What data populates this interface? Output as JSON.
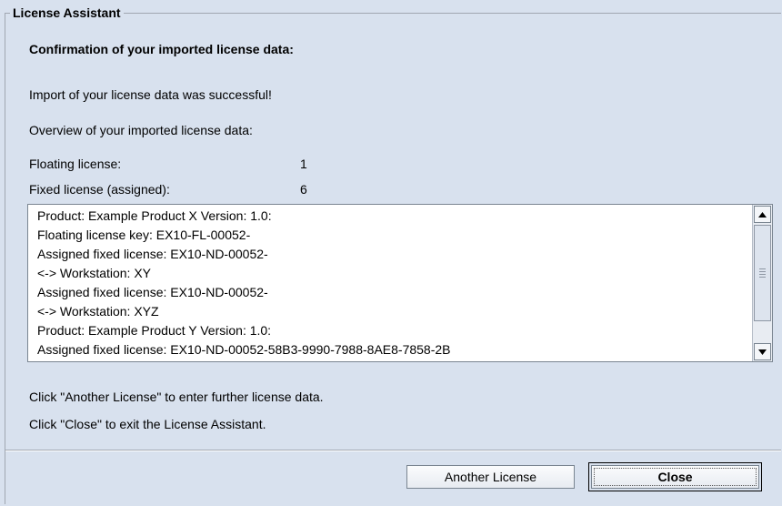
{
  "dialog": {
    "group_title": "License Assistant",
    "heading": "Confirmation of your imported license data:",
    "success_message": "Import of your license data was successful!",
    "overview_label": "Overview of your imported license data:",
    "floating_label": "Floating license:",
    "floating_value": "1",
    "fixed_label": "Fixed license (assigned):",
    "fixed_value": "6",
    "license_lines": [
      "Product: Example Product X  Version: 1.0:",
      "Floating license key: EX10-FL-00052-",
      "Assigned fixed license: EX10-ND-00052-",
      " <-> Workstation: XY",
      "Assigned fixed license: EX10-ND-00052-",
      " <-> Workstation: XYZ",
      "Product: Example Product Y  Version: 1.0:",
      "Assigned fixed license: EX10-ND-00052-58B3-9990-7988-8AE8-7858-2B"
    ],
    "hint_another": "Click \"Another License\" to enter further license data.",
    "hint_close": "Click \"Close\" to exit the License Assistant.",
    "another_button_label": "Another License",
    "close_button_label": "Close"
  }
}
